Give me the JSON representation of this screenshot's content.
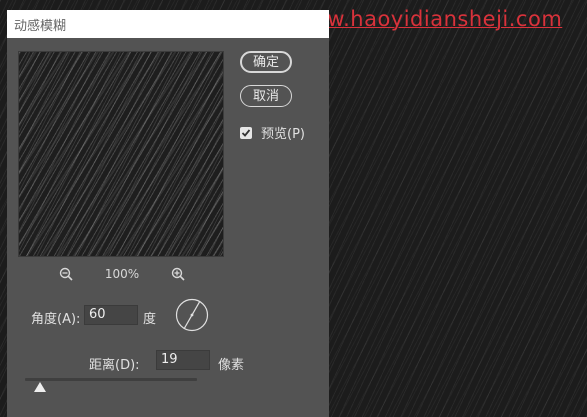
{
  "watermark": "www.haoyidiansheji.com",
  "dialog": {
    "title": "动感模糊",
    "ok_label": "确定",
    "cancel_label": "取消",
    "preview_label": "预览(P)",
    "preview_checked": true,
    "zoom_value": "100%",
    "angle_label": "角度(A):",
    "angle_value": "60",
    "angle_unit": "度",
    "distance_label": "距离(D):",
    "distance_value": "19",
    "distance_unit": "像素",
    "distance_slider_fraction": 0.02
  },
  "icons": {
    "zoom_out": "zoom-out-icon",
    "zoom_in": "zoom-in-icon",
    "check": "check-icon",
    "angle_dial": "angle-dial-icon"
  },
  "colors": {
    "dialog_bg": "#535353",
    "watermark": "#d9323b"
  }
}
